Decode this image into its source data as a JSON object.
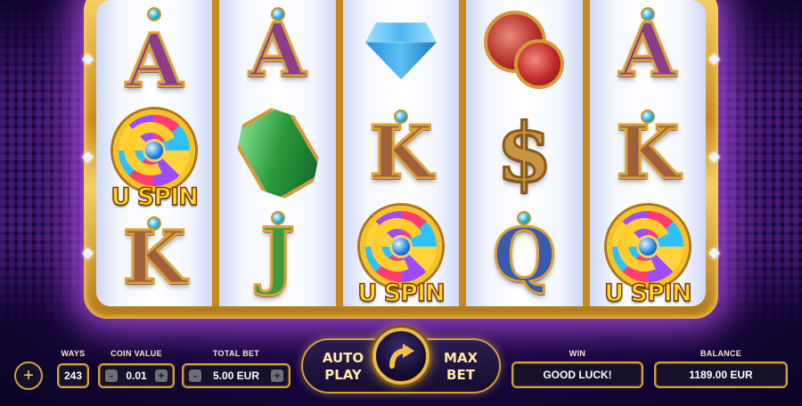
{
  "reels": [
    [
      {
        "symbol": "A",
        "kind": "letter"
      },
      {
        "symbol": "uspin",
        "kind": "wild",
        "text": "U SPIN"
      },
      {
        "symbol": "K",
        "kind": "letter"
      }
    ],
    [
      {
        "symbol": "A",
        "kind": "letter"
      },
      {
        "symbol": "emerald",
        "kind": "gem"
      },
      {
        "symbol": "J",
        "kind": "letter"
      }
    ],
    [
      {
        "symbol": "diamond",
        "kind": "gem"
      },
      {
        "symbol": "K",
        "kind": "letter"
      },
      {
        "symbol": "uspin",
        "kind": "wild",
        "text": "U SPIN"
      }
    ],
    [
      {
        "symbol": "ruby",
        "kind": "gem"
      },
      {
        "symbol": "$",
        "kind": "letter"
      },
      {
        "symbol": "Q",
        "kind": "letter"
      }
    ],
    [
      {
        "symbol": "A",
        "kind": "letter"
      },
      {
        "symbol": "K",
        "kind": "letter"
      },
      {
        "symbol": "uspin",
        "kind": "wild",
        "text": "U SPIN"
      }
    ]
  ],
  "controls": {
    "menu_icon": "plus-icon",
    "ways_label": "WAYS",
    "ways_value": "243",
    "coin_value_label": "COIN VALUE",
    "coin_value": "0.01",
    "total_bet_label": "TOTAL BET",
    "total_bet": "5.00 EUR",
    "minus": "-",
    "plus": "+",
    "autoplay_line1": "AUTO",
    "autoplay_line2": "PLAY",
    "maxbet_line1": "MAX",
    "maxbet_line2": "BET",
    "spin_icon": "curved-arrow-icon",
    "win_label": "WIN",
    "win_value": "GOOD LUCK!",
    "balance_label": "BALANCE",
    "balance_value": "1189.00 EUR"
  },
  "colors": {
    "frame_gold": "#e0a93a",
    "glow_purple": "#c85aff",
    "panel_dark": "#17102a"
  }
}
